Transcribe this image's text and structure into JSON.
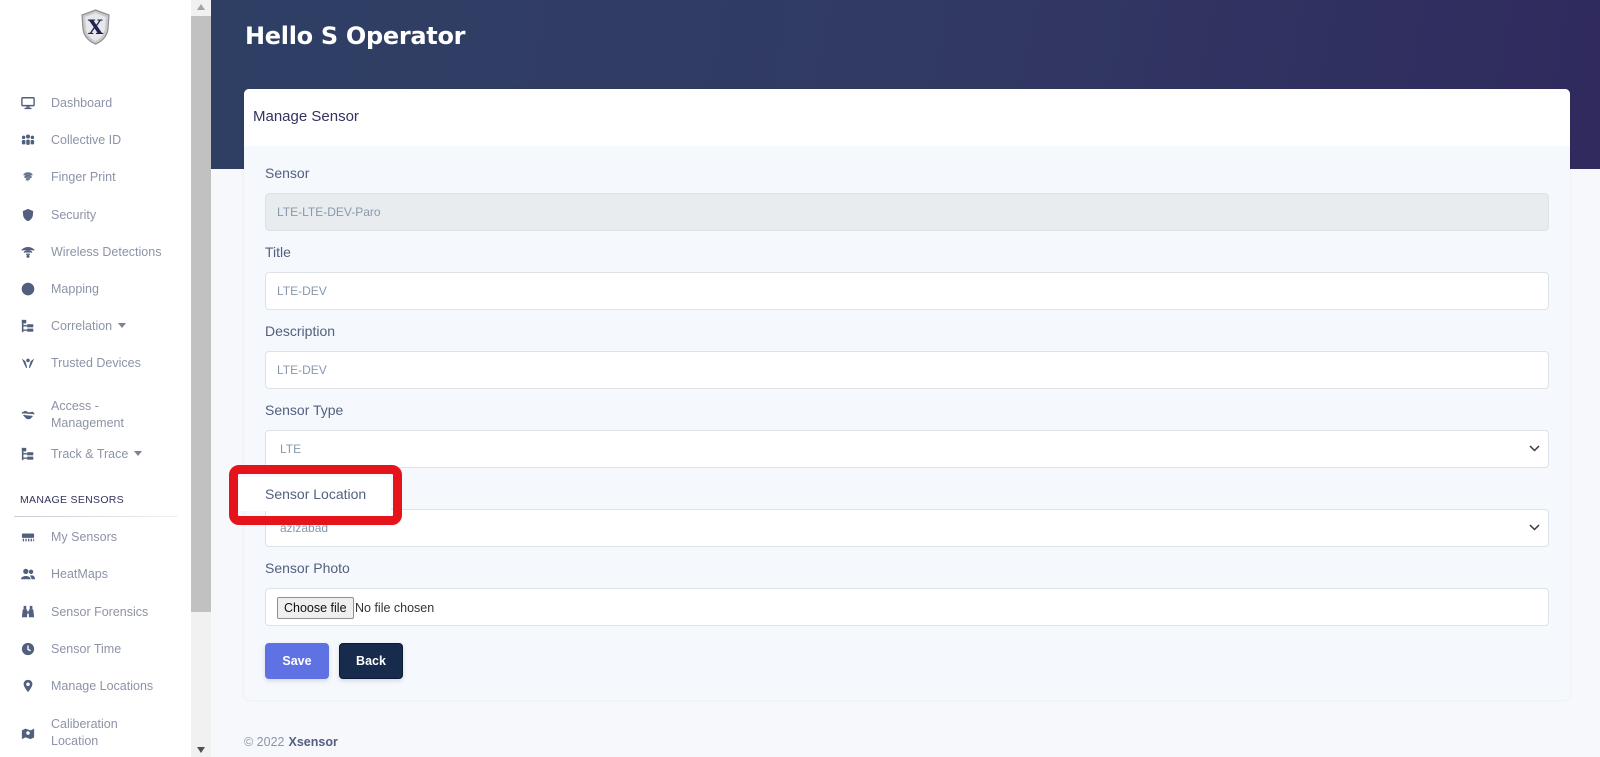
{
  "header": {
    "greeting": "Hello S Operator"
  },
  "logo": {
    "letter": "X"
  },
  "sidebar": {
    "items": [
      {
        "label": "Dashboard",
        "icon": "monitor-icon"
      },
      {
        "label": "Collective ID",
        "icon": "users-group-icon"
      },
      {
        "label": "Finger Print",
        "icon": "fingerprint-icon"
      },
      {
        "label": "Security",
        "icon": "shield-icon"
      },
      {
        "label": "Wireless Detections",
        "icon": "wifi-icon"
      },
      {
        "label": "Mapping",
        "icon": "globe-icon"
      },
      {
        "label": "Correlation",
        "icon": "sitemap-icon",
        "dropdown": true
      },
      {
        "label": "Trusted Devices",
        "icon": "hands-icon"
      },
      {
        "label": "Access - Management",
        "label_line1": "Access -",
        "label_line2": "Management",
        "icon": "handshake-icon"
      },
      {
        "label": "Track & Trace",
        "icon": "sitemap-icon",
        "dropdown": true
      }
    ],
    "section_heading": "MANAGE SENSORS",
    "sensor_items": [
      {
        "label": "My Sensors",
        "icon": "sensor-icon"
      },
      {
        "label": "HeatMaps",
        "icon": "users-icon"
      },
      {
        "label": "Sensor Forensics",
        "icon": "binoculars-icon"
      },
      {
        "label": "Sensor Time",
        "icon": "clock-icon"
      },
      {
        "label": "Manage Locations",
        "icon": "map-pin-icon"
      },
      {
        "label": "Caliberation Location",
        "label_line1": "Caliberation",
        "label_line2": "Location",
        "icon": "map-marked-icon"
      }
    ]
  },
  "form": {
    "title": "Manage Sensor",
    "sensor": {
      "label": "Sensor",
      "value": "LTE-LTE-DEV-Paro"
    },
    "title_field": {
      "label": "Title",
      "value": "LTE-DEV"
    },
    "description": {
      "label": "Description",
      "value": "LTE-DEV"
    },
    "sensor_type": {
      "label": "Sensor Type",
      "value": "LTE"
    },
    "sensor_location": {
      "label": "Sensor Location",
      "value": "azizabad"
    },
    "sensor_photo": {
      "label": "Sensor Photo",
      "button": "Choose file",
      "status": "No file chosen"
    },
    "save_label": "Save",
    "back_label": "Back"
  },
  "footer": {
    "copyright": "© 2022",
    "brand": "Xsensor"
  },
  "colors": {
    "primary": "#5e72e4",
    "dark": "#172b4d",
    "header_gradient_start": "#2f3f64",
    "header_gradient_end": "#302a5e",
    "highlight": "#e5141b"
  }
}
